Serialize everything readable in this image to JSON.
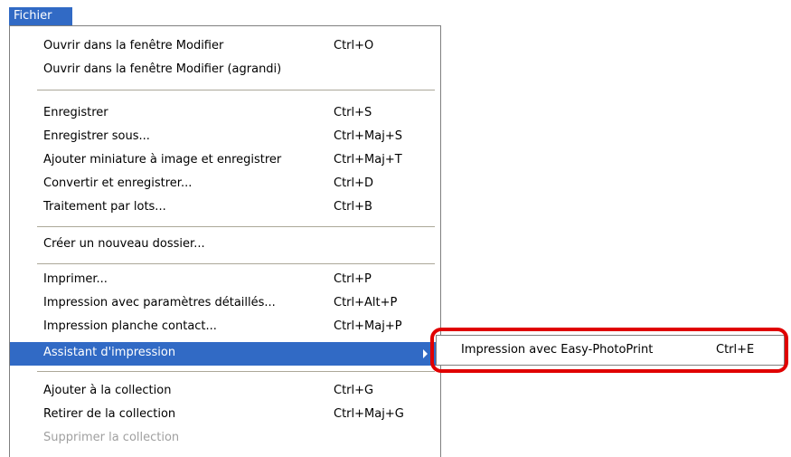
{
  "menu": {
    "title": "Fichier",
    "items": [
      {
        "label": "Ouvrir dans la fenêtre Modifier",
        "shortcut": "Ctrl+O"
      },
      {
        "label": "Ouvrir dans la fenêtre Modifier (agrandi)",
        "shortcut": ""
      },
      {
        "label": "Enregistrer",
        "shortcut": "Ctrl+S"
      },
      {
        "label": "Enregistrer sous...",
        "shortcut": "Ctrl+Maj+S"
      },
      {
        "label": "Ajouter miniature à image et enregistrer",
        "shortcut": "Ctrl+Maj+T"
      },
      {
        "label": "Convertir et enregistrer...",
        "shortcut": "Ctrl+D"
      },
      {
        "label": "Traitement par lots...",
        "shortcut": "Ctrl+B"
      },
      {
        "label": "Créer un nouveau dossier...",
        "shortcut": ""
      },
      {
        "label": "Imprimer...",
        "shortcut": "Ctrl+P"
      },
      {
        "label": "Impression avec paramètres détaillés...",
        "shortcut": "Ctrl+Alt+P"
      },
      {
        "label": "Impression planche contact...",
        "shortcut": "Ctrl+Maj+P"
      },
      {
        "label": "Assistant d'impression",
        "shortcut": ""
      },
      {
        "label": "Ajouter à la collection",
        "shortcut": "Ctrl+G"
      },
      {
        "label": "Retirer de la collection",
        "shortcut": "Ctrl+Maj+G"
      },
      {
        "label": "Supprimer la collection",
        "shortcut": ""
      }
    ]
  },
  "submenu": {
    "label": "Impression avec Easy-PhotoPrint",
    "shortcut": "Ctrl+E"
  },
  "colors": {
    "selection": "#316ac5",
    "highlight_ring": "#e00000",
    "disabled_text": "#a0a0a0"
  }
}
